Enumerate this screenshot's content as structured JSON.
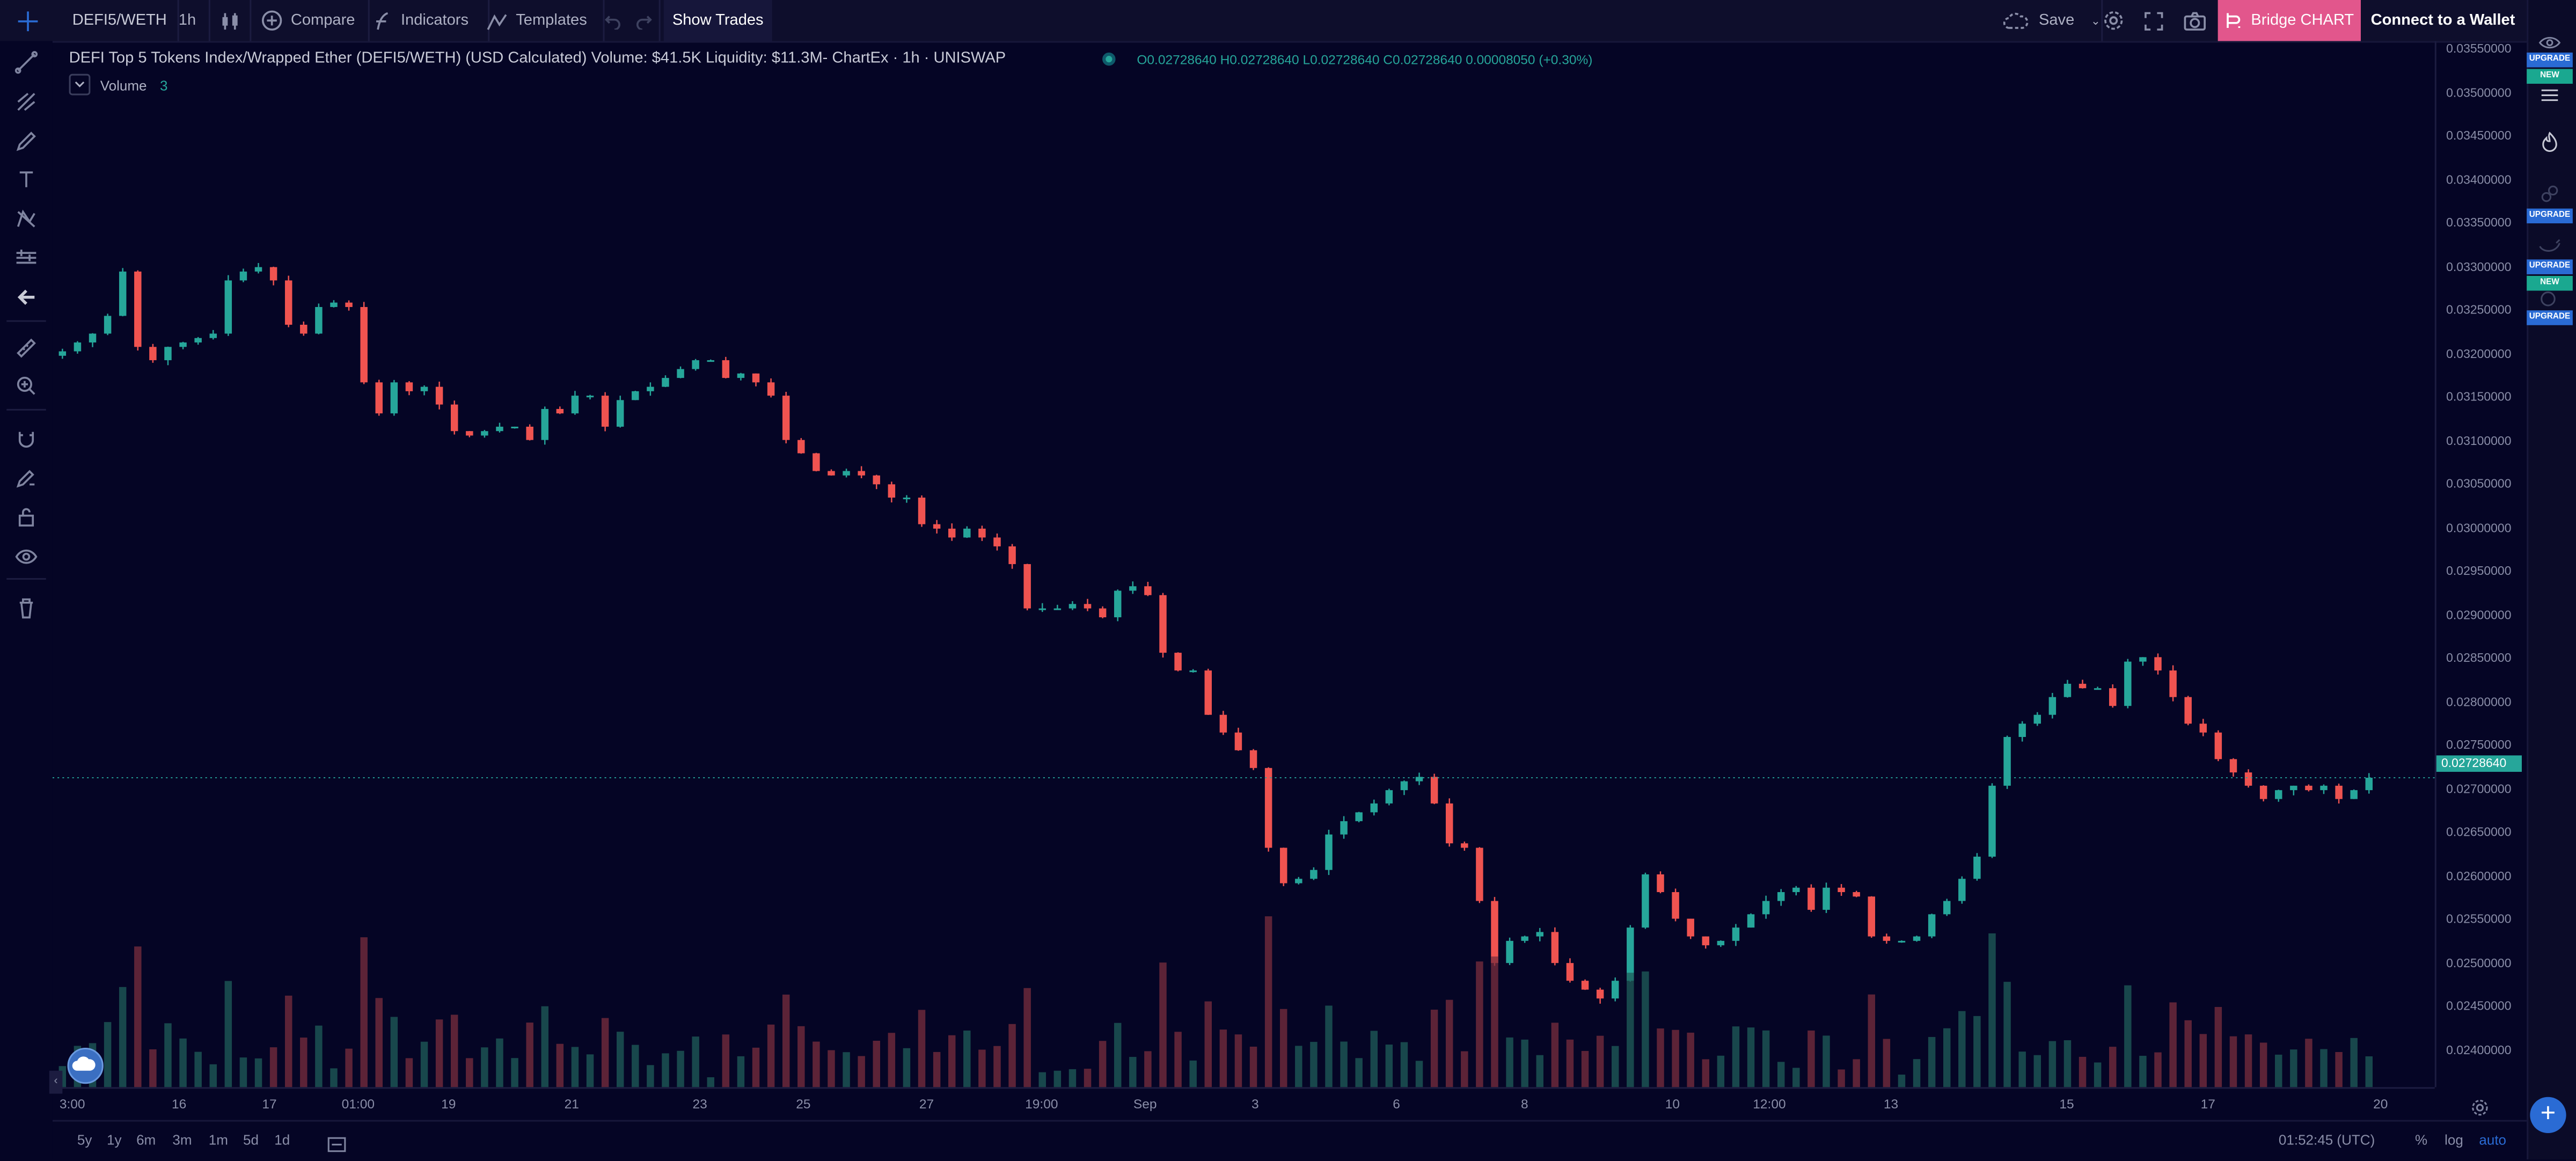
{
  "toolbar": {
    "symbol": "DEFI5/WETH",
    "interval": "1h",
    "compare": "Compare",
    "indicators": "Indicators",
    "templates": "Templates",
    "show_trades": "Show Trades",
    "save": "Save",
    "bridge": "Bridge CHART",
    "connect": "Connect to a Wallet"
  },
  "legend": {
    "title": "DEFI Top 5 Tokens Index/Wrapped Ether (DEFI5/WETH) (USD Calculated) Volume: $41.5K Liquidity: $11.3M- ChartEx · 1h · UNISWAP",
    "ohlc": "O0.02728640  H0.02728640  L0.02728640  C0.02728640  0.00008050 (+0.30%)",
    "volume_label": "Volume",
    "volume_value": "3"
  },
  "right_panel": {
    "badges": [
      {
        "text": "UPGRADE",
        "kind": "up"
      },
      {
        "text": "NEW",
        "kind": "nw"
      },
      {
        "text": "UPGRADE",
        "kind": "up"
      },
      {
        "text": "UPGRADE",
        "kind": "up"
      },
      {
        "text": "NEW",
        "kind": "nw"
      },
      {
        "text": "UPGRADE",
        "kind": "up"
      }
    ]
  },
  "price_axis": {
    "labels": [
      "0.03550000",
      "0.03500000",
      "0.03450000",
      "0.03400000",
      "0.03350000",
      "0.03300000",
      "0.03250000",
      "0.03200000",
      "0.03150000",
      "0.03100000",
      "0.03050000",
      "0.03000000",
      "0.02950000",
      "0.02900000",
      "0.02850000",
      "0.02800000",
      "0.02750000",
      "0.02700000",
      "0.02650000",
      "0.02600000",
      "0.02550000",
      "0.02500000",
      "0.02450000",
      "0.02400000"
    ],
    "last_price": "0.02728640"
  },
  "time_axis": {
    "labels": [
      "3:00",
      "16",
      "17",
      "01:00",
      "19",
      "21",
      "23",
      "25",
      "27",
      "19:00",
      "Sep",
      "3",
      "6",
      "8",
      "10",
      "12:00",
      "13",
      "15",
      "17",
      "20"
    ]
  },
  "bottom": {
    "ranges": [
      "5y",
      "1y",
      "6m",
      "3m",
      "1m",
      "5d",
      "1d"
    ],
    "clock": "01:52:45 (UTC)",
    "percent": "%",
    "log": "log",
    "auto": "auto"
  },
  "colors": {
    "up": "#26a69a",
    "down": "#ef5350",
    "background": "#050525",
    "accent": "#e2568c"
  },
  "chart_data": {
    "type": "candlestick",
    "title": "DEFI Top 5 Tokens Index/Wrapped Ether (DEFI5/WETH) (USD Calculated)",
    "ylim": [
      0.0238,
      0.0356
    ],
    "grid": false,
    "close": [
      0.0321,
      0.0322,
      0.0323,
      0.0325,
      0.033,
      0.03215,
      0.032,
      0.03215,
      0.0322,
      0.03225,
      0.0323,
      0.0329,
      0.033,
      0.03305,
      0.0329,
      0.0324,
      0.0323,
      0.0326,
      0.03265,
      0.0326,
      0.03175,
      0.0314,
      0.03175,
      0.03165,
      0.0317,
      0.0315,
      0.0312,
      0.03115,
      0.0312,
      0.03125,
      0.03125,
      0.0311,
      0.03145,
      0.0314,
      0.0316,
      0.0316,
      0.03125,
      0.03155,
      0.03165,
      0.0317,
      0.0318,
      0.0319,
      0.032,
      0.032,
      0.0318,
      0.03185,
      0.03175,
      0.0316,
      0.0311,
      0.03095,
      0.03075,
      0.0307,
      0.03075,
      0.0307,
      0.0306,
      0.03045,
      0.03045,
      0.03015,
      0.0301,
      0.03,
      0.0301,
      0.03,
      0.0299,
      0.0297,
      0.0292,
      0.0292,
      0.0292,
      0.02925,
      0.0292,
      0.0291,
      0.0294,
      0.02945,
      0.02935,
      0.0287,
      0.0285,
      0.0285,
      0.028,
      0.0278,
      0.0276,
      0.0274,
      0.0265,
      0.0261,
      0.02615,
      0.02625,
      0.02665,
      0.0268,
      0.0269,
      0.027,
      0.02715,
      0.02725,
      0.0273,
      0.027,
      0.02655,
      0.0265,
      0.0259,
      0.0252,
      0.02545,
      0.0255,
      0.02555,
      0.0252,
      0.025,
      0.0249,
      0.0248,
      0.025,
      0.0256,
      0.0262,
      0.026,
      0.0257,
      0.0255,
      0.0254,
      0.02545,
      0.0256,
      0.02575,
      0.0259,
      0.026,
      0.02605,
      0.0258,
      0.02605,
      0.026,
      0.02595,
      0.0255,
      0.02545,
      0.02545,
      0.0255,
      0.02575,
      0.0259,
      0.02615,
      0.0264,
      0.0272,
      0.02775,
      0.0279,
      0.028,
      0.0282,
      0.02835,
      0.0283,
      0.0283,
      0.0281,
      0.0286,
      0.02865,
      0.0285,
      0.0282,
      0.0279,
      0.0278,
      0.0275,
      0.02735,
      0.0272,
      0.02705,
      0.02715,
      0.0272,
      0.02715,
      0.0272,
      0.02705,
      0.02715,
      0.02729
    ]
  }
}
